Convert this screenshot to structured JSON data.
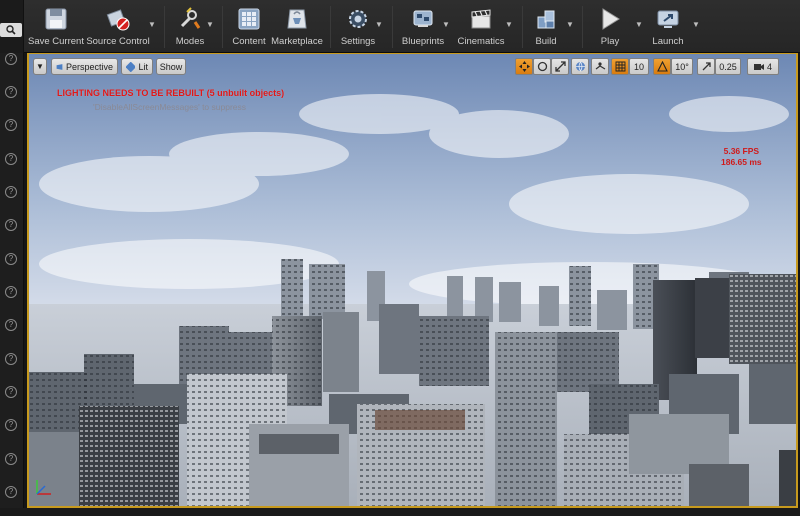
{
  "toolbar": {
    "buttons": [
      {
        "label": "Save Current",
        "icon": "save-icon"
      },
      {
        "label": "Source Control",
        "icon": "source-control-icon"
      },
      {
        "label": "Modes",
        "icon": "modes-icon"
      },
      {
        "label": "Content",
        "icon": "content-icon"
      },
      {
        "label": "Marketplace",
        "icon": "marketplace-icon"
      },
      {
        "label": "Settings",
        "icon": "settings-icon"
      },
      {
        "label": "Blueprints",
        "icon": "blueprints-icon"
      },
      {
        "label": "Cinematics",
        "icon": "cinematics-icon"
      },
      {
        "label": "Build",
        "icon": "build-icon"
      },
      {
        "label": "Play",
        "icon": "play-icon"
      },
      {
        "label": "Launch",
        "icon": "launch-icon"
      }
    ]
  },
  "viewport": {
    "perspective_label": "Perspective",
    "lit_label": "Lit",
    "show_label": "Show",
    "grid_snap_value": "10",
    "rotation_snap_value": "10°",
    "scale_snap_value": "0.25",
    "camera_speed_value": "4",
    "lighting_warning": "LIGHTING NEEDS TO BE REBUILT (5 unbuilt objects)",
    "suppress_hint": "'DisableAllScreenMessages' to suppress",
    "fps_line1": "5.36 FPS",
    "fps_line2": "186.65 ms"
  },
  "colors": {
    "viewport_border": "#c79a1e",
    "warning_text": "#e01818",
    "toolbar_bg": "#2a2a2a"
  }
}
